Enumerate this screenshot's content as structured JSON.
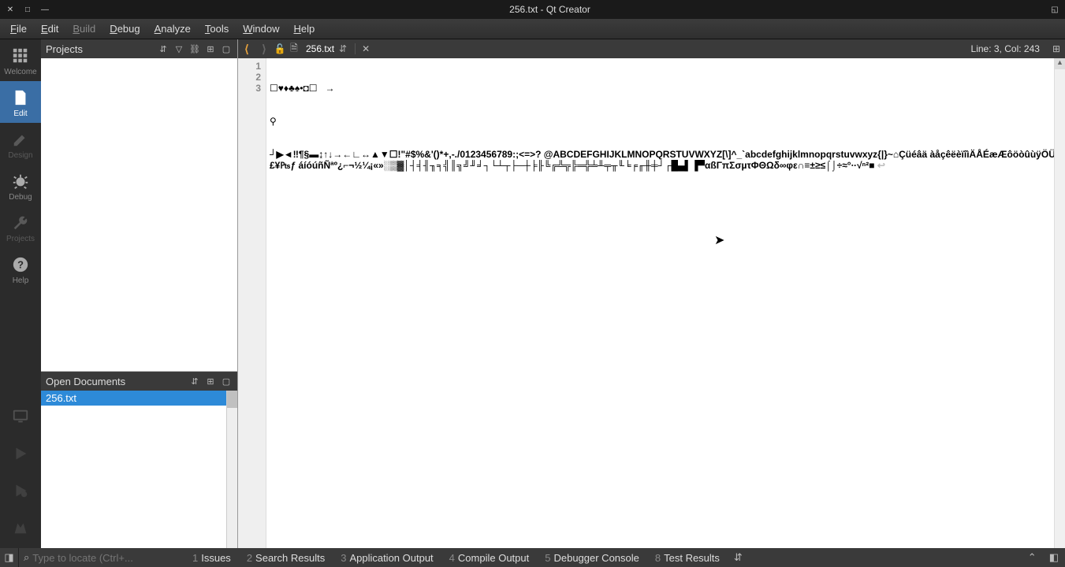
{
  "window": {
    "title": "256.txt - Qt Creator"
  },
  "menu": {
    "items": [
      "File",
      "Edit",
      "Build",
      "Debug",
      "Analyze",
      "Tools",
      "Window",
      "Help"
    ]
  },
  "modebar": {
    "items": [
      {
        "id": "welcome",
        "label": "Welcome"
      },
      {
        "id": "edit",
        "label": "Edit"
      },
      {
        "id": "design",
        "label": "Design"
      },
      {
        "id": "debug",
        "label": "Debug"
      },
      {
        "id": "projects",
        "label": "Projects"
      },
      {
        "id": "help",
        "label": "Help"
      }
    ],
    "active": "edit"
  },
  "projects_panel": {
    "title": "Projects"
  },
  "opendocs_panel": {
    "title": "Open Documents",
    "items": [
      "256.txt"
    ],
    "selected": 0
  },
  "editor": {
    "tab_title": "256.txt",
    "cursor_pos": "Line: 3, Col: 243",
    "lines": {
      "l1": "☐♥♦♣♠•◘☐   →",
      "l2": "⚲",
      "l3": "┘▶◄‼¶§▬↨↑↓→←∟↔▲▼☐!\"#$%&'()*+,-./0123456789:;<=>? @ABCDEFGHIJKLMNOPQRSTUVWXYZ[\\]^_`abcdefghijklmnopqrstuvwxyz{|}~⌂Çüéâä àåçêëèïîìÄÅÉæÆôöòûùÿÖÜ¢£¥₧ƒ áíóúñÑªº¿⌐¬½¼¡«»░▒▓│┤╡╢╖╕╣║╗╝╜╛┐└┴┬├─┼╞╟╚╔╩╦╠═╬╧╨╤╥╙╘╒╓╫╪┘┌█▄▌▐▀αßΓπΣσµτΦΘΩδ∞φε∩≡±≥≤⌠⌡÷≈°∙·√ⁿ²■"
    },
    "line_numbers": [
      "1",
      "2",
      "3"
    ]
  },
  "statusbar": {
    "locator_placeholder": "Type to locate (Ctrl+...",
    "outputs": [
      {
        "n": "1",
        "label": "Issues"
      },
      {
        "n": "2",
        "label": "Search Results"
      },
      {
        "n": "3",
        "label": "Application Output"
      },
      {
        "n": "4",
        "label": "Compile Output"
      },
      {
        "n": "5",
        "label": "Debugger Console"
      },
      {
        "n": "8",
        "label": "Test Results"
      }
    ]
  }
}
